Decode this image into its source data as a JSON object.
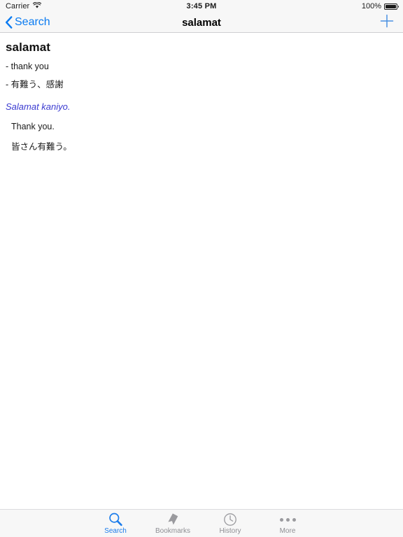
{
  "status_bar": {
    "carrier": "Carrier",
    "wifi_icon": "wifi-icon",
    "time": "3:45 PM",
    "battery_percent": "100%",
    "battery_icon": "battery-full-icon"
  },
  "nav_bar": {
    "back_label": "Search",
    "back_icon": "chevron-left-icon",
    "title": "salamat",
    "add_icon": "plus-icon"
  },
  "entry": {
    "headword": "salamat",
    "senses": [
      "- thank you",
      "- 有難う、感謝"
    ],
    "example": "Salamat kaniyo.",
    "example_translations": [
      "Thank you.",
      "皆さん有難う。"
    ]
  },
  "tab_bar": {
    "tabs": [
      {
        "label": "Search",
        "icon": "magnifier-icon",
        "selected": true
      },
      {
        "label": "Bookmarks",
        "icon": "bookmark-icon",
        "selected": false
      },
      {
        "label": "History",
        "icon": "clock-icon",
        "selected": false
      },
      {
        "label": "More",
        "icon": "ellipsis-icon",
        "selected": false
      }
    ]
  },
  "colors": {
    "accent": "#1b7ceb",
    "nav_tint": "#0b7bf1",
    "example_blue": "#3a3ad0",
    "inactive_gray": "#8e8e93",
    "chrome_bg": "#f7f7f7"
  }
}
